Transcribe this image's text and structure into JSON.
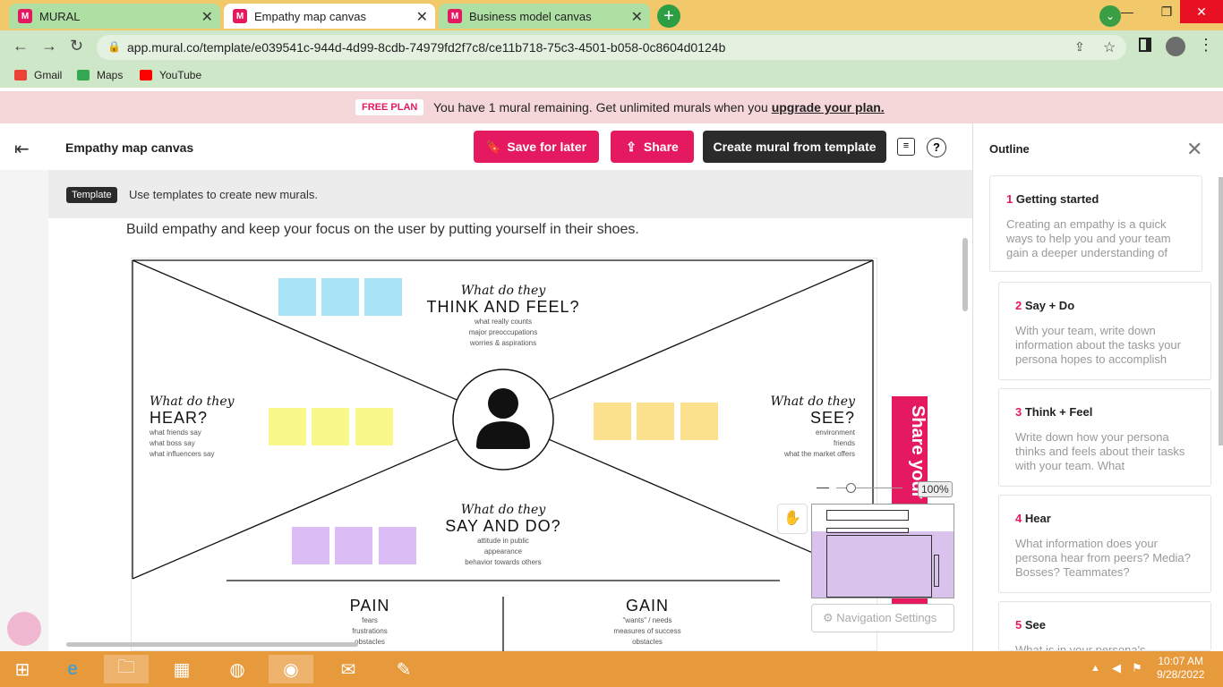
{
  "browser": {
    "tabs": [
      {
        "label": "MURAL",
        "active": false
      },
      {
        "label": "Empathy map canvas",
        "active": true
      },
      {
        "label": "Business model canvas",
        "active": false
      }
    ],
    "favicon_letter": "M",
    "url": "app.mural.co/template/e039541c-944d-4d99-8cdb-74979fd2f7c8/ce11b718-75c3-4501-b058-0c8604d0124b",
    "bookmarks": [
      "Gmail",
      "Maps",
      "YouTube"
    ]
  },
  "banner": {
    "badge": "FREE PLAN",
    "text": "You have 1 mural remaining. Get unlimited murals when you ",
    "link": "upgrade your plan."
  },
  "header": {
    "title": "Empathy map canvas",
    "save_label": "Save for later",
    "share_label": "Share",
    "create_label": "Create mural from template"
  },
  "template_bar": {
    "tag": "Template",
    "text": "Use templates to create new murals."
  },
  "canvas": {
    "subtitle": "Build empathy and keep your focus on the user by putting yourself in their shoes.",
    "sections": {
      "think": {
        "script": "What do they",
        "caps": "THINK AND FEEL?",
        "items": [
          "what really counts",
          "major preoccupations",
          "worries & aspirations"
        ]
      },
      "hear": {
        "script": "What do they",
        "caps": "HEAR?",
        "items": [
          "what friends say",
          "what boss say",
          "what influencers say"
        ]
      },
      "see": {
        "script": "What do they",
        "caps": "SEE?",
        "items": [
          "environment",
          "friends",
          "what the market offers"
        ]
      },
      "say": {
        "script": "What do they",
        "caps": "SAY AND DO?",
        "items": [
          "attitude in public",
          "appearance",
          "behavior towards others"
        ]
      },
      "pain": {
        "caps": "PAIN",
        "items": [
          "fears",
          "frustrations",
          "obstacles"
        ]
      },
      "gain": {
        "caps": "GAIN",
        "items": [
          "\"wants\" / needs",
          "measures of success",
          "obstacles"
        ]
      }
    },
    "colors": {
      "blue": "#a7e4f5",
      "yellow": "#f8f98a",
      "orange": "#fbe08e",
      "purple": "#dcbcf5"
    }
  },
  "overlay": {
    "share_vertical": "Share your work",
    "zoom": "100%",
    "nav_settings": "Navigation Settings"
  },
  "outline": {
    "title": "Outline",
    "items": [
      {
        "num": "1",
        "title": "Getting started",
        "desc": "Creating an empathy is a quick ways to help you and your team gain a deeper understanding of"
      },
      {
        "num": "2",
        "title": "Say + Do",
        "desc": "With your team, write down information about the tasks your persona hopes to accomplish"
      },
      {
        "num": "3",
        "title": "Think + Feel",
        "desc": "Write down how your persona thinks and feels about their tasks with your team. What"
      },
      {
        "num": "4",
        "title": "Hear",
        "desc": "What information does your persona hear from peers? Media? Bosses? Teammates?"
      },
      {
        "num": "5",
        "title": "See",
        "desc": "What is in your persona's"
      }
    ]
  },
  "taskbar": {
    "time": "10:07 AM",
    "date": "9/28/2022"
  }
}
